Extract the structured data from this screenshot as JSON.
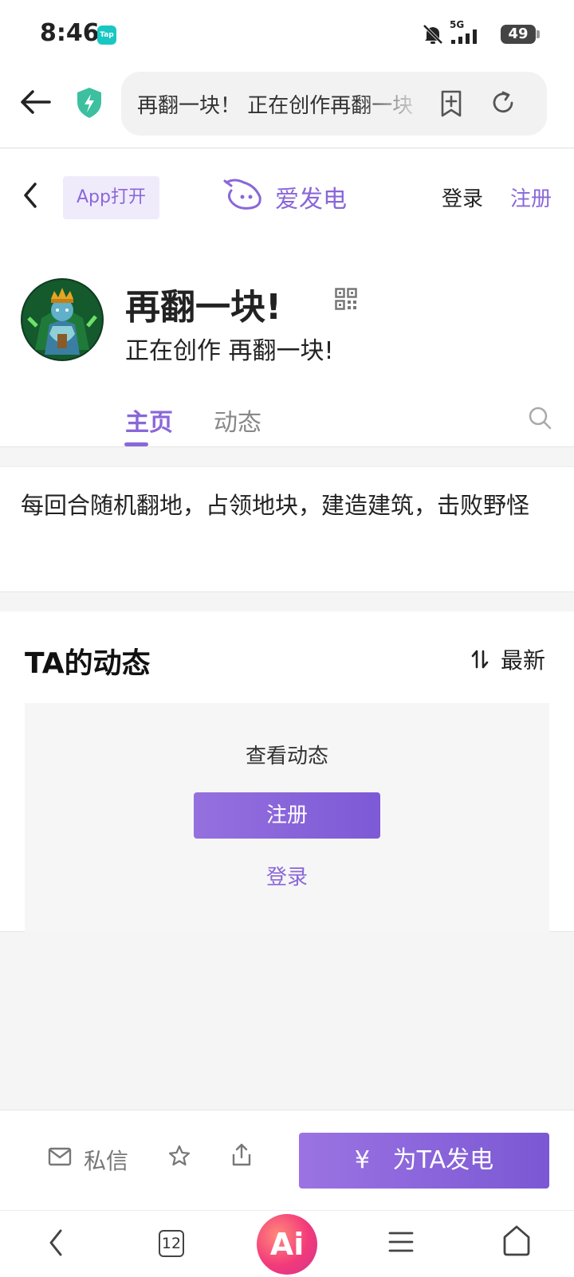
{
  "status_bar": {
    "time": "8:46",
    "app_badge": "Tap",
    "network": "5G",
    "battery": "49"
  },
  "browser": {
    "url_title": "再翻一块！ 正在创作再翻一块！"
  },
  "site_header": {
    "app_open": "App打开",
    "brand_name": "爱发电",
    "login": "登录",
    "register": "注册"
  },
  "profile": {
    "name": "再翻一块!",
    "subtitle": "正在创作 再翻一块!",
    "tabs": [
      {
        "label": "主页",
        "active": true
      },
      {
        "label": "动态",
        "active": false
      }
    ]
  },
  "description": "每回合随机翻地，占领地块，建造建筑，击败野怪",
  "feed": {
    "title": "TA的动态",
    "sort_label": "最新",
    "gate_label": "查看动态",
    "register_button": "注册",
    "login_link": "登录"
  },
  "action_bar": {
    "message_label": "私信",
    "charge_button": "为TA发电",
    "currency_symbol": "¥"
  },
  "system_nav": {
    "tab_count": "12",
    "ai_label": "Ai"
  },
  "colors": {
    "accent": "#8a67d9",
    "button_gradient_start": "#9b73e2",
    "button_gradient_end": "#7b58d4",
    "shield_green": "#3cc0a0"
  }
}
